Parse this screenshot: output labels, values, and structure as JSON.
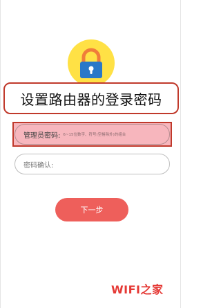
{
  "title": "设置路由器的登录密码",
  "lock_icon": "lock-icon",
  "colors": {
    "lock_circle": "#ffe145",
    "lock_body": "#2a78c8",
    "lock_shackle": "#f07d3a",
    "highlight_border": "#c0392b",
    "highlight_fill": "#f7b6bd",
    "button": "#ee5f5b",
    "watermark": "#e53935"
  },
  "form": {
    "admin_password_label": "管理员密码:",
    "admin_password_placeholder": "6~15位数字、符号(空格除外)的组合",
    "confirm_password_label": "密码确认:"
  },
  "next_button_label": "下一步",
  "watermark": "WIFI之家"
}
